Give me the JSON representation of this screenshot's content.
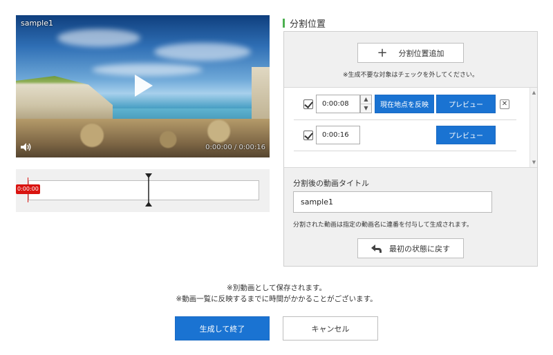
{
  "video": {
    "label": "sample1",
    "time": "0:00:00 / 0:00:16",
    "play_icon": "play-icon",
    "volume_icon": "volume-icon"
  },
  "timeline": {
    "current_badge": "0:00:00"
  },
  "split": {
    "heading": "分割位置",
    "add_label": "分割位置追加",
    "note": "※生成不要な対象はチェックを外してください。",
    "rows": [
      {
        "time": "0:00:08",
        "reflect_label": "現在地点を反映",
        "preview_label": "プレビュー",
        "delete_icon": "close-icon"
      },
      {
        "time": "0:00:16",
        "preview_label": "プレビュー"
      }
    ],
    "title_label": "分割後の動画タイトル",
    "title_value": "sample1",
    "title_note": "分割された動画は指定の動画名に連番を付与して生成されます。",
    "reset_label": "最初の状態に戻す"
  },
  "footer": {
    "note_line1": "※別動画として保存されます。",
    "note_line2": "※動画一覧に反映するまでに時間がかかることがございます。",
    "save_label": "生成して終了",
    "cancel_label": "キャンセル"
  },
  "colors": {
    "accent": "#1a73d2",
    "heading_bar": "#4cb050",
    "timecode": "#d9130f"
  }
}
